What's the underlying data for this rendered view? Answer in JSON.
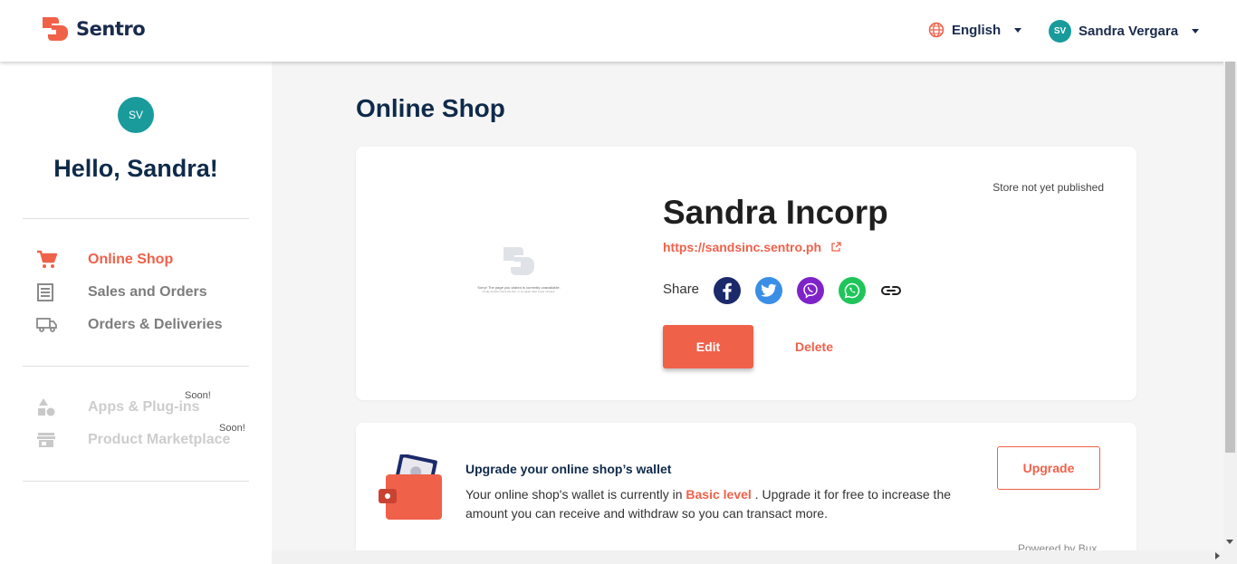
{
  "header": {
    "logo_text": "Sentro",
    "language": "English",
    "user_initials": "SV",
    "user_name": "Sandra Vergara"
  },
  "sidebar": {
    "avatar_initials": "SV",
    "greeting": "Hello, Sandra!",
    "nav_primary": [
      {
        "label": "Online Shop",
        "icon": "cart-icon",
        "active": true
      },
      {
        "label": "Sales and Orders",
        "icon": "receipt-icon",
        "active": false
      },
      {
        "label": "Orders & Deliveries",
        "icon": "truck-icon",
        "active": false
      }
    ],
    "nav_secondary": [
      {
        "label": "Apps & Plug-ins",
        "icon": "shapes-icon",
        "badge": "Soon!"
      },
      {
        "label": "Product Marketplace",
        "icon": "store-icon",
        "badge": "Soon!"
      }
    ]
  },
  "main": {
    "page_title": "Online Shop",
    "store": {
      "status": "Store not yet published",
      "name": "Sandra Incorp",
      "url": "https://sandsinc.sentro.ph",
      "share_label": "Share",
      "share_targets": [
        "facebook-icon",
        "twitter-icon",
        "viber-icon",
        "whatsapp-icon",
        "link-icon"
      ],
      "edit_label": "Edit",
      "delete_label": "Delete",
      "preview_line1": "Sorry! The page you visited is currently unavailable.",
      "preview_line2": "Kindly double check the link, or try again after a few minutes."
    },
    "wallet": {
      "title": "Upgrade your online shop’s wallet",
      "desc_before": "Your online shop's wallet is currently in ",
      "level": "Basic level",
      "desc_after": " . Upgrade it for free to increase the amount you can receive and withdraw so you can transact more.",
      "upgrade_label": "Upgrade",
      "powered_by": "Powered by Bux"
    }
  },
  "colors": {
    "accent": "#f0614a",
    "navy": "#0f2a4a",
    "teal": "#199b9c"
  }
}
